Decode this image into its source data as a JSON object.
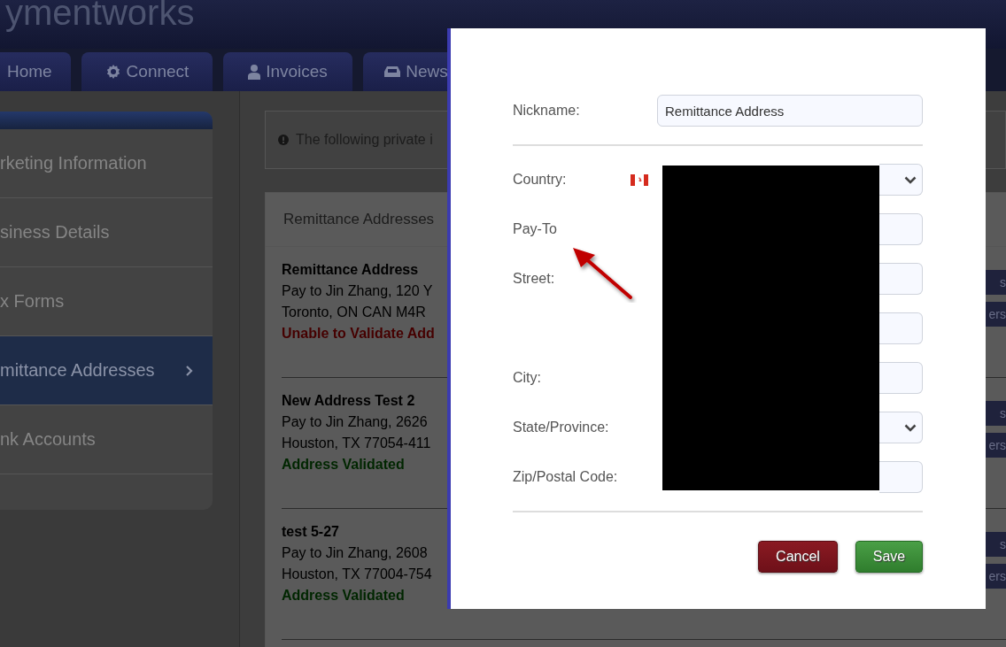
{
  "header": {
    "logo": "ymentworks"
  },
  "nav_tabs": [
    {
      "label": "Home"
    },
    {
      "label": "Connect"
    },
    {
      "label": "Invoices"
    },
    {
      "label": "News"
    }
  ],
  "sidebar": {
    "items": [
      {
        "label": "rketing Information",
        "selected": false
      },
      {
        "label": "siness Details",
        "selected": false
      },
      {
        "label": "x Forms",
        "selected": false
      },
      {
        "label": "mittance Addresses",
        "selected": true
      },
      {
        "label": "nk Accounts",
        "selected": false
      }
    ]
  },
  "notice": {
    "text": "The following private i"
  },
  "panel": {
    "title": "Remittance Addresses",
    "addresses": [
      {
        "name": "Remittance Address",
        "line_1": "Pay to Jin Zhang, 120 Y",
        "line_2": "Toronto, ON CAN M4R",
        "status": "Unable to Validate Add",
        "validated": false,
        "side_buttons": [
          "s",
          "ers"
        ]
      },
      {
        "name": "New Address Test 2",
        "line_1": "Pay to Jin Zhang, 2626",
        "line_2": "Houston, TX 77054-411",
        "status": "Address Validated",
        "validated": true,
        "side_buttons": [
          "s",
          "ers"
        ]
      },
      {
        "name": "test 5-27",
        "line_1": "Pay to Jin Zhang, 2608",
        "line_2": "Houston, TX 77004-754",
        "status": "Address Validated",
        "validated": true,
        "side_buttons": [
          "s",
          "ers"
        ]
      }
    ]
  },
  "modal": {
    "nickname": {
      "label": "Nickname:",
      "value": "Remittance Address"
    },
    "fields": [
      {
        "label": "Country:",
        "kind": "country-select"
      },
      {
        "label": "Pay-To",
        "kind": "text"
      },
      {
        "label": "Street:",
        "kind": "text"
      },
      {
        "kind": "text"
      },
      {
        "label": "City:",
        "kind": "text"
      },
      {
        "label": "State/Province:",
        "kind": "select"
      },
      {
        "label": "Zip/Postal Code:",
        "kind": "text"
      }
    ],
    "buttons": [
      {
        "label": "Cancel",
        "kind": "cancel"
      },
      {
        "label": "Save",
        "kind": "primary"
      }
    ]
  }
}
